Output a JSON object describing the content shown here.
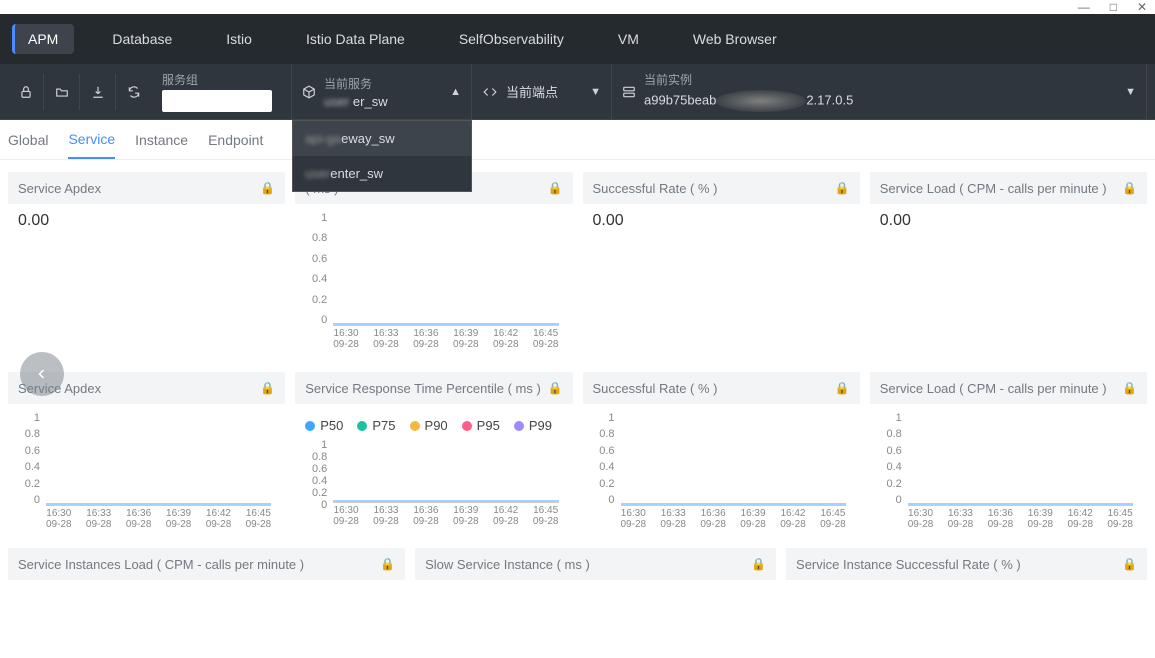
{
  "titlebar": {
    "min": "—",
    "max": "□",
    "close": "✕"
  },
  "nav": {
    "items": [
      "APM",
      "Database",
      "Istio",
      "Istio Data Plane",
      "SelfObservability",
      "VM",
      "Web Browser"
    ],
    "active": 0
  },
  "filters": {
    "service_group": {
      "label": "服务组",
      "value": ""
    },
    "current_service": {
      "label": "当前服务",
      "value": "user-center_sw"
    },
    "current_endpoint": {
      "label": "当前端点"
    },
    "current_instance": {
      "label": "当前实例",
      "value_prefix": "a99b75beab",
      "value_suffix": "2.17.0.5"
    },
    "dropdown_options": [
      "api-gateway_sw",
      "user-center_sw"
    ]
  },
  "subtabs": {
    "items": [
      "Global",
      "Service",
      "Instance",
      "Endpoint"
    ],
    "active": 1
  },
  "cards": {
    "row1": [
      {
        "title": "Service Apdex",
        "value": "0.00"
      },
      {
        "title": "( ms )",
        "value": ""
      },
      {
        "title": "Successful Rate ( % )",
        "value": "0.00"
      },
      {
        "title": "Service Load ( CPM - calls per minute )",
        "value": "0.00"
      }
    ],
    "row2": [
      {
        "title": "Service Apdex"
      },
      {
        "title": "Service Response Time Percentile ( ms )"
      },
      {
        "title": "Successful Rate ( % )"
      },
      {
        "title": "Service Load ( CPM - calls per minute )"
      }
    ],
    "row3": [
      {
        "title": "Service Instances Load ( CPM - calls per minute )"
      },
      {
        "title": "Slow Service Instance ( ms )"
      },
      {
        "title": "Service Instance Successful Rate ( % )"
      }
    ]
  },
  "legend_percentiles": [
    {
      "label": "P50",
      "color": "#3fa7ff"
    },
    {
      "label": "P75",
      "color": "#19c3a0"
    },
    {
      "label": "P90",
      "color": "#f5b941"
    },
    {
      "label": "P95",
      "color": "#ff5c8a"
    },
    {
      "label": "P99",
      "color": "#9d8cff"
    }
  ],
  "chart_data": [
    {
      "type": "line",
      "title": "( ms )",
      "ylabel": "",
      "xlabel": "",
      "ylim": [
        0,
        1
      ],
      "yticks": [
        1,
        0.8,
        0.6,
        0.4,
        0.2,
        0
      ],
      "x": [
        "16:30 09-28",
        "16:33 09-28",
        "16:36 09-28",
        "16:39 09-28",
        "16:42 09-28",
        "16:45 09-28"
      ],
      "series": [
        {
          "name": "ms",
          "values": [
            0,
            0,
            0,
            0,
            0,
            0
          ]
        }
      ]
    },
    {
      "type": "line",
      "title": "Service Apdex",
      "ylim": [
        0,
        1
      ],
      "yticks": [
        1,
        0.8,
        0.6,
        0.4,
        0.2,
        0
      ],
      "x": [
        "16:30 09-28",
        "16:33 09-28",
        "16:36 09-28",
        "16:39 09-28",
        "16:42 09-28",
        "16:45 09-28"
      ],
      "series": [
        {
          "name": "apdex",
          "values": [
            0,
            0,
            0,
            0,
            0,
            0
          ]
        }
      ]
    },
    {
      "type": "line",
      "title": "Service Response Time Percentile ( ms )",
      "ylim": [
        0,
        1
      ],
      "yticks": [
        1,
        0.8,
        0.6,
        0.4,
        0.2,
        0
      ],
      "x": [
        "16:30 09-28",
        "16:33 09-28",
        "16:36 09-28",
        "16:39 09-28",
        "16:42 09-28",
        "16:45 09-28"
      ],
      "series": [
        {
          "name": "P50",
          "values": [
            0,
            0,
            0,
            0,
            0,
            0
          ]
        },
        {
          "name": "P75",
          "values": [
            0,
            0,
            0,
            0,
            0,
            0
          ]
        },
        {
          "name": "P90",
          "values": [
            0,
            0,
            0,
            0,
            0,
            0
          ]
        },
        {
          "name": "P95",
          "values": [
            0,
            0,
            0,
            0,
            0,
            0
          ]
        },
        {
          "name": "P99",
          "values": [
            0,
            0,
            0,
            0,
            0,
            0
          ]
        }
      ]
    },
    {
      "type": "line",
      "title": "Successful Rate ( % )",
      "ylim": [
        0,
        1
      ],
      "yticks": [
        1,
        0.8,
        0.6,
        0.4,
        0.2,
        0
      ],
      "x": [
        "16:30 09-28",
        "16:33 09-28",
        "16:36 09-28",
        "16:39 09-28",
        "16:42 09-28",
        "16:45 09-28"
      ],
      "series": [
        {
          "name": "rate",
          "values": [
            0,
            0,
            0,
            0,
            0,
            0
          ]
        }
      ]
    },
    {
      "type": "line",
      "title": "Service Load ( CPM - calls per minute )",
      "ylim": [
        0,
        1
      ],
      "yticks": [
        1,
        0.8,
        0.6,
        0.4,
        0.2,
        0
      ],
      "x": [
        "16:30 09-28",
        "16:33 09-28",
        "16:36 09-28",
        "16:39 09-28",
        "16:42 09-28",
        "16:45 09-28"
      ],
      "series": [
        {
          "name": "cpm",
          "values": [
            0,
            0,
            0,
            0,
            0,
            0
          ]
        }
      ]
    }
  ]
}
